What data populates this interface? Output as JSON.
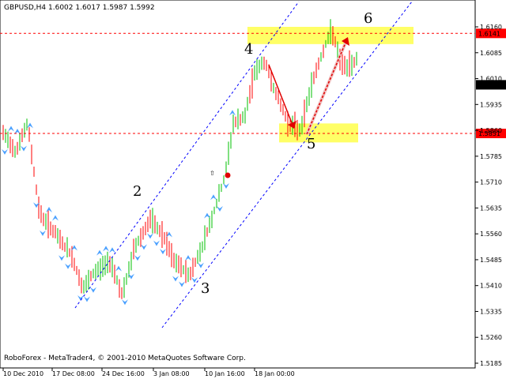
{
  "header": {
    "title": "GBPUSD,H4  1.6002 1.6017 1.5987 1.5992"
  },
  "footer": {
    "copyright": "RoboForex - MetaTrader4, © 2001-2010 MetaQuotes Software Corp."
  },
  "chart_data": {
    "type": "line",
    "symbol": "GBPUSD",
    "timeframe": "H4",
    "last_bar": {
      "open": 1.6002,
      "high": 1.6017,
      "low": 1.5987,
      "close": 1.5992
    },
    "price_ticks": [
      "1.6160",
      "1.6085",
      "1.6010",
      "1.5935",
      "1.5860",
      "1.5785",
      "1.5710",
      "1.5635",
      "1.5560",
      "1.5485",
      "1.5410",
      "1.5335",
      "1.5260",
      "1.5185"
    ],
    "time_ticks": [
      "10 Dec 2010",
      "17 Dec 08:00",
      "24 Dec 16:00",
      "3 Jan 08:00",
      "10 Jan 16:00",
      "18 Jan 00:00"
    ],
    "ylim": [
      1.5185,
      1.62
    ],
    "current_price": "1.5992",
    "levels": [
      {
        "price": 1.6141,
        "label": "1.6141"
      },
      {
        "price": 1.5851,
        "label": "1.5851"
      }
    ],
    "wave_labels": [
      "2",
      "3",
      "4",
      "5",
      "6"
    ],
    "colors": {
      "bull_bar": "#00c000",
      "bear_bar": "#ff0000",
      "level_line": "#ff0000",
      "zone": "#ffff66",
      "channel": "#0000ff",
      "fractal": "#4aa0ff",
      "arrow": "#e00000"
    }
  }
}
